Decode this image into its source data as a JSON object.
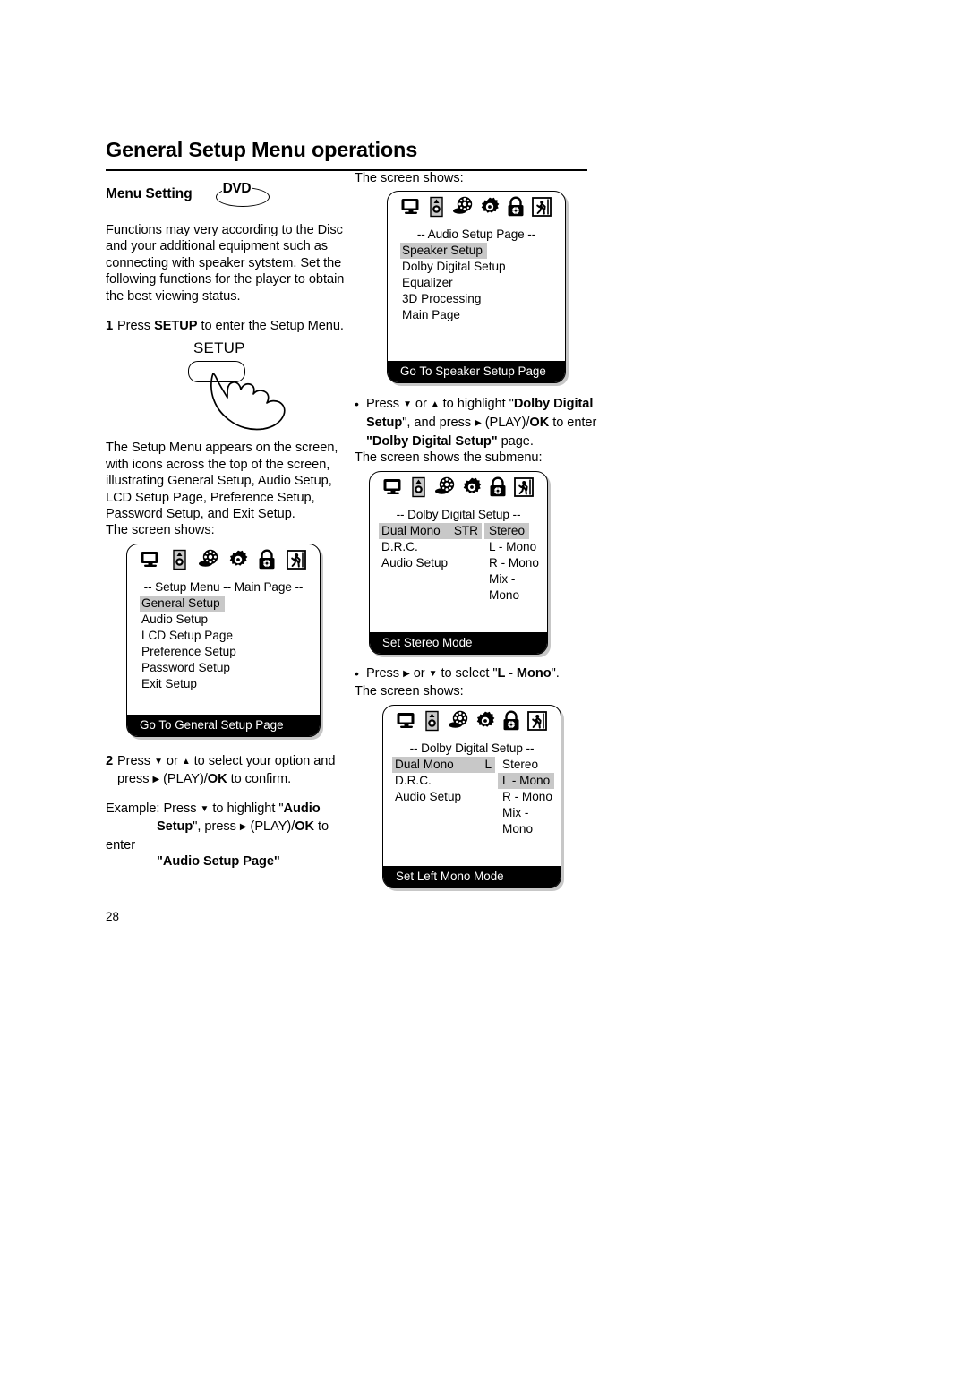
{
  "document": {
    "page_title": "General Setup Menu operations",
    "page_number": "28"
  },
  "left_column": {
    "section_label": "Menu Setting",
    "disc_badge": "DVD",
    "intro_paragraph": "Functions may very according to the Disc and your additional equipment such as connecting with speaker sytstem. Set the following functions for the player to obtain the best viewing status.",
    "step1": {
      "number": "1",
      "text_before": "Press ",
      "key": "SETUP",
      "text_after": " to enter the Setup Menu."
    },
    "setup_button_label": "SETUP",
    "after_step1_paragraph": "The Setup Menu appears on the screen, with icons across the top of the screen, illustrating General Setup, Audio Setup, LCD Setup Page, Preference Setup, Password Setup, and Exit Setup.",
    "screen_shows_label": "The screen shows:",
    "step2": {
      "number": "2",
      "line1_a": "Press ",
      "line1_b": " or ",
      "line1_c": " to select your option and",
      "line2_a": "press ",
      "line2_b": " (PLAY)/",
      "line2_c": "OK",
      "line2_d": " to confirm."
    },
    "example": {
      "lead": "Example: Press ",
      "part1": " to highlight \"",
      "bold1": "Audio",
      "bold2": "Setup",
      "part2": "\", press ",
      "part3": " (PLAY)/",
      "bold3": "OK",
      "part4": " to enter",
      "quoted": "\"Audio Setup Page\""
    }
  },
  "right_column": {
    "screen_shows_label": "The screen shows:",
    "screen_shows_submenu_label": "The screen shows the submenu:",
    "bullet1": {
      "a": "Press ",
      "b": " or ",
      "c": " to highlight \"",
      "bold1": "Dolby Digital",
      "bold2": "Setup",
      "d": "\", and press ",
      "e": " (PLAY)/",
      "bold3": "OK",
      "f": " to enter",
      "bold4": "\"Dolby Digital Setup\"",
      "g": " page."
    },
    "bullet2": {
      "a": "Press ",
      "b": " or ",
      "c": " to select \"",
      "bold1": "L - Mono",
      "d": "\"."
    }
  },
  "icons": [
    "monitor-icon",
    "speaker-icon",
    "film-reel-icon",
    "gear-icon",
    "padlock-icon",
    "exit-running-man-icon"
  ],
  "screens": {
    "setup_main": {
      "header_left": "-- Setup Menu --",
      "header_right": "Main Page  --",
      "items": [
        {
          "label": "General Setup",
          "highlighted": true
        },
        {
          "label": "Audio Setup",
          "highlighted": false
        },
        {
          "label": "LCD Setup Page",
          "highlighted": false
        },
        {
          "label": "Preference Setup",
          "highlighted": false
        },
        {
          "label": "Password Setup",
          "highlighted": false
        },
        {
          "label": "Exit Setup",
          "highlighted": false
        }
      ],
      "status": "Go To General Setup Page"
    },
    "audio_setup": {
      "header": "--  Audio Setup Page  --",
      "items": [
        {
          "label": "Speaker Setup",
          "highlighted": true
        },
        {
          "label": "Dolby Digital Setup",
          "highlighted": false
        },
        {
          "label": "Equalizer",
          "highlighted": false
        },
        {
          "label": "3D Processing",
          "highlighted": false
        },
        {
          "label": "Main Page",
          "highlighted": false
        }
      ],
      "status": "Go To Speaker Setup Page"
    },
    "dolby_stereo": {
      "header": "--  Dolby Digital Setup  --",
      "left_items": [
        {
          "label": "Dual Mono",
          "value": "STR",
          "highlighted": true
        },
        {
          "label": "D.R.C.",
          "value": "",
          "highlighted": false
        },
        {
          "label": "Audio Setup",
          "value": "",
          "highlighted": false
        }
      ],
      "options": [
        {
          "label": "Stereo",
          "highlighted": true
        },
        {
          "label": "L - Mono",
          "highlighted": false
        },
        {
          "label": "R - Mono",
          "highlighted": false
        },
        {
          "label": "Mix - Mono",
          "highlighted": false
        }
      ],
      "status": "Set Stereo Mode"
    },
    "dolby_lmono": {
      "header": "--  Dolby Digital Setup  --",
      "left_items": [
        {
          "label": "Dual Mono",
          "value": "L",
          "highlighted": true
        },
        {
          "label": "D.R.C.",
          "value": "",
          "highlighted": false
        },
        {
          "label": "Audio Setup",
          "value": "",
          "highlighted": false
        }
      ],
      "options": [
        {
          "label": "Stereo",
          "highlighted": false
        },
        {
          "label": "L - Mono",
          "highlighted": true
        },
        {
          "label": "R - Mono",
          "highlighted": false
        },
        {
          "label": "Mix - Mono",
          "highlighted": false
        }
      ],
      "status": "Set Left Mono Mode"
    }
  },
  "colors": {
    "highlight": "#c8c8c8",
    "status_bar": "#000000",
    "text": "#000000"
  }
}
